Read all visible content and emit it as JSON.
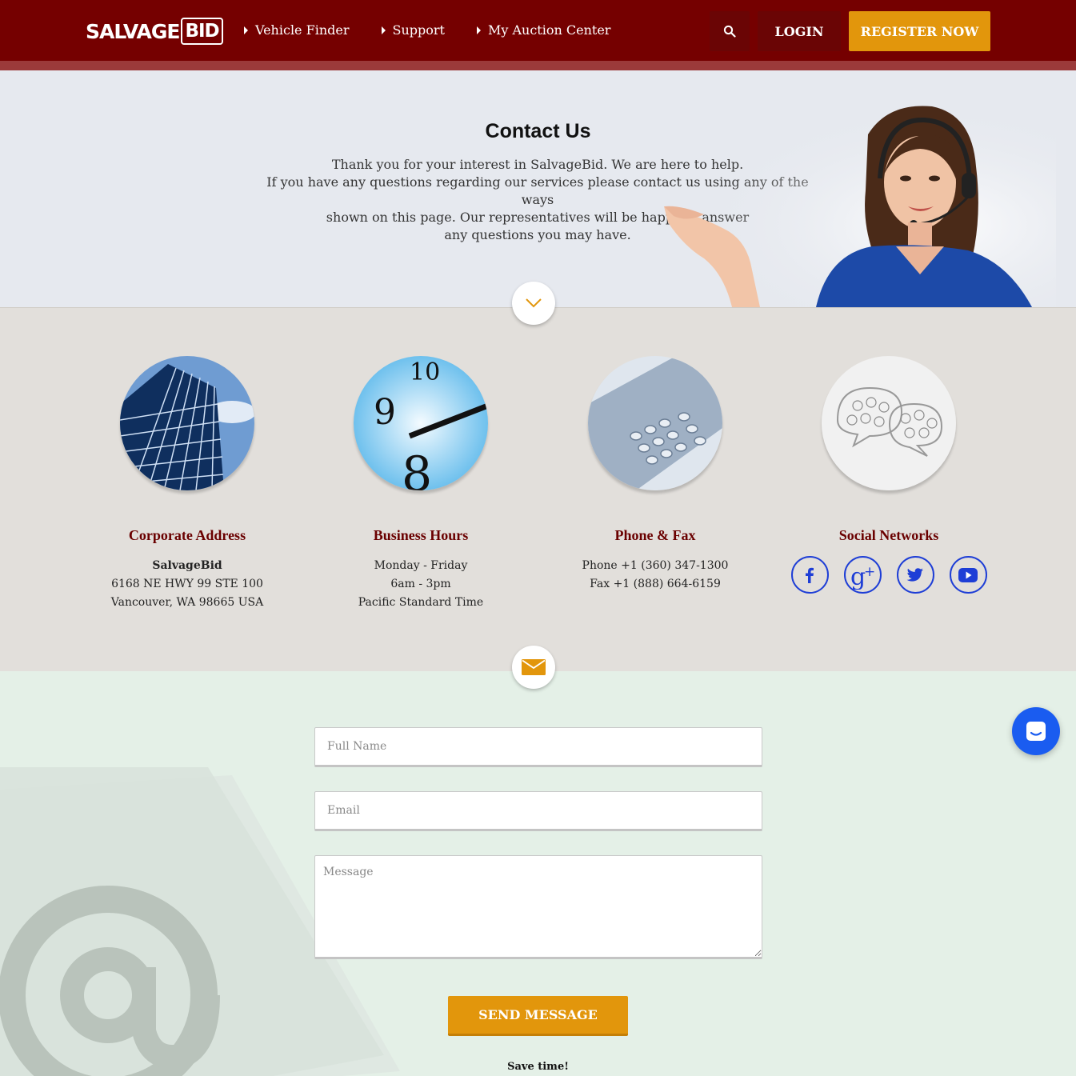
{
  "header": {
    "logo_main": "SALVAGE",
    "logo_bid": "BID",
    "nav": [
      "Vehicle Finder",
      "Support",
      "My Auction Center"
    ],
    "login_label": "LOGIN",
    "register_label": "REGISTER NOW"
  },
  "hero": {
    "title": "Contact Us",
    "lines": [
      "Thank you for your interest in SalvageBid. We are here to help.",
      "If you have any questions regarding our services please contact us using any of the ways",
      "shown on this page. Our representatives will be happy to answer",
      "any questions you may have."
    ]
  },
  "info": {
    "address": {
      "heading": "Corporate Address",
      "company": "SalvageBid",
      "line1": "6168 NE HWY 99 STE 100",
      "line2": "Vancouver, WA 98665 USA"
    },
    "hours": {
      "heading": "Business Hours",
      "line1": "Monday - Friday",
      "line2": "6am - 3pm",
      "line3": "Pacific Standard Time"
    },
    "phone": {
      "heading": "Phone & Fax",
      "line1": "Phone +1 (360) 347-1300",
      "line2": "Fax +1 (888) 664-6159"
    },
    "social": {
      "heading": "Social Networks",
      "icons": [
        "facebook-icon",
        "google-plus-icon",
        "twitter-icon",
        "youtube-icon"
      ]
    }
  },
  "form": {
    "name_placeholder": "Full Name",
    "email_placeholder": "Email",
    "message_placeholder": "Message",
    "send_label": "SEND MESSAGE",
    "note": "Save time!"
  },
  "colors": {
    "header": "#750000",
    "accent": "#e2960c",
    "heading": "#6a0000",
    "social": "#1e3ed6",
    "chat": "#1a5cf0"
  }
}
